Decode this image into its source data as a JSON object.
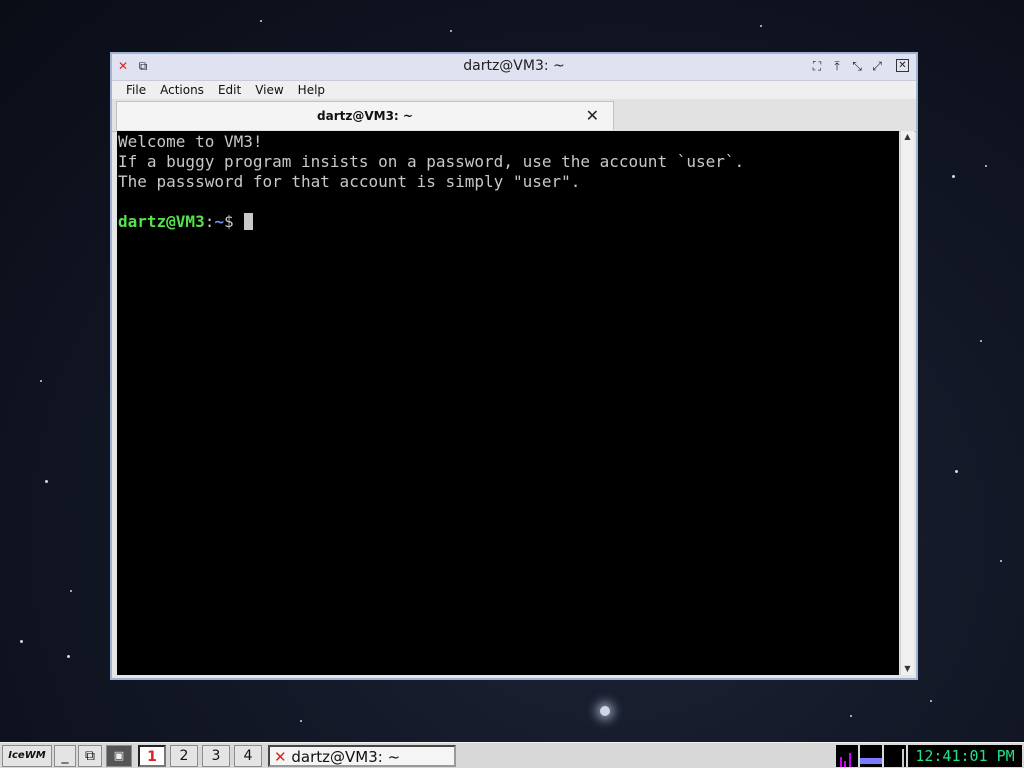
{
  "window": {
    "title": "dartz@VM3: ~",
    "menu": [
      "File",
      "Actions",
      "Edit",
      "View",
      "Help"
    ],
    "tab_title": "dartz@VM3: ~"
  },
  "terminal": {
    "lines": [
      "Welcome to VM3!",
      "If a buggy program insists on a password, use the account `user`.",
      "The passsword for that account is simply \"user\"."
    ],
    "prompt_user": "dartz@VM3",
    "prompt_sep": ":",
    "prompt_path": "~",
    "prompt_symbol": "$ "
  },
  "taskbar": {
    "start_label": "IceWM",
    "workspaces": [
      "1",
      "2",
      "3",
      "4"
    ],
    "task_title": "dartz@VM3: ~",
    "clock": "12:41:01 PM"
  },
  "colors": {
    "terminal_bg": "#000000",
    "prompt_user": "#55e24a",
    "prompt_path": "#6f8fe8",
    "clock_text": "#22e08a"
  }
}
